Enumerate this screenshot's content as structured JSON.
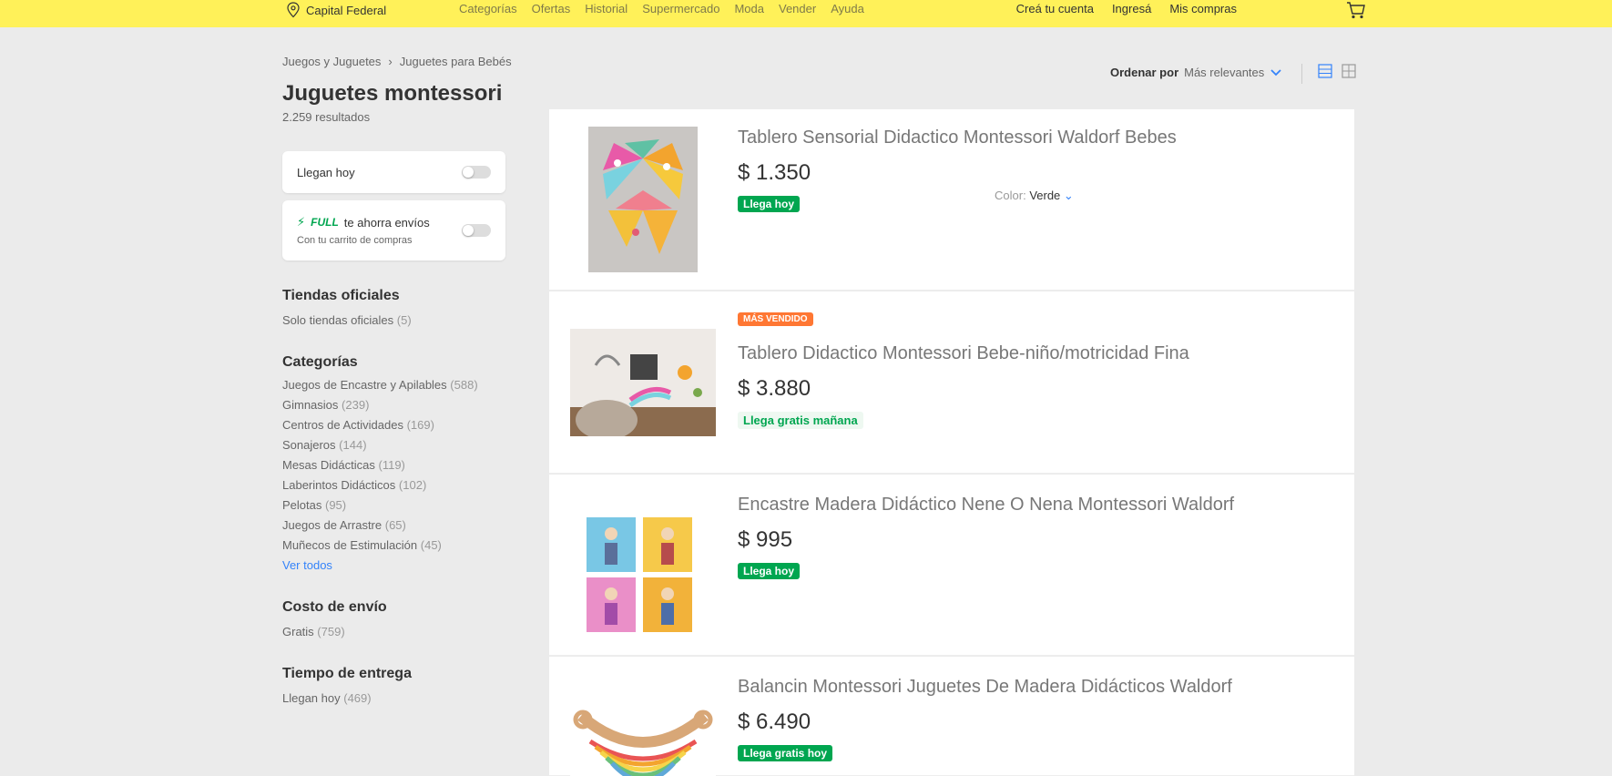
{
  "header": {
    "location": "Capital Federal",
    "nav": [
      "Categorías",
      "Ofertas",
      "Historial",
      "Supermercado",
      "Moda",
      "Vender",
      "Ayuda"
    ],
    "user_nav": [
      "Creá tu cuenta",
      "Ingresá",
      "Mis compras"
    ]
  },
  "breadcrumb": [
    "Juegos y Juguetes",
    "Juguetes para Bebés"
  ],
  "search": {
    "title": "Juguetes montessori",
    "results": "2.259 resultados"
  },
  "filters": {
    "arrive_today": "Llegan hoy",
    "full_brand": "FULL",
    "full_text": "te ahorra envíos",
    "full_sub": "Con tu carrito de compras"
  },
  "sections": {
    "stores": {
      "title": "Tiendas oficiales",
      "items": [
        {
          "label": "Solo tiendas oficiales",
          "count": "(5)"
        }
      ]
    },
    "categories": {
      "title": "Categorías",
      "items": [
        {
          "label": "Juegos de Encastre y Apilables",
          "count": "(588)"
        },
        {
          "label": "Gimnasios",
          "count": "(239)"
        },
        {
          "label": "Centros de Actividades",
          "count": "(169)"
        },
        {
          "label": "Sonajeros",
          "count": "(144)"
        },
        {
          "label": "Mesas Didácticas",
          "count": "(119)"
        },
        {
          "label": "Laberintos Didácticos",
          "count": "(102)"
        },
        {
          "label": "Pelotas",
          "count": "(95)"
        },
        {
          "label": "Juegos de Arrastre",
          "count": "(65)"
        },
        {
          "label": "Muñecos de Estimulación",
          "count": "(45)"
        }
      ],
      "see_all": "Ver todos"
    },
    "shipping_cost": {
      "title": "Costo de envío",
      "items": [
        {
          "label": "Gratis",
          "count": "(759)"
        }
      ]
    },
    "delivery_time": {
      "title": "Tiempo de entrega",
      "items": [
        {
          "label": "Llegan hoy",
          "count": "(469)"
        }
      ]
    }
  },
  "sort": {
    "label": "Ordenar por",
    "value": "Más relevantes"
  },
  "products": [
    {
      "title": "Tablero Sensorial Didactico Montessori Waldorf Bebes",
      "price": "$ 1.350",
      "badge": "Llega hoy",
      "variant_label": "Color:",
      "variant_value": "Verde"
    },
    {
      "pre_badge": "MÁS VENDIDO",
      "title": "Tablero Didactico Montessori Bebe-niño/motricidad Fina",
      "price": "$ 3.880",
      "shipping": "Llega gratis mañana"
    },
    {
      "title": "Encastre Madera Didáctico Nene O Nena Montessori Waldorf",
      "price": "$ 995",
      "badge": "Llega hoy"
    },
    {
      "title": "Balancin Montessori Juguetes De Madera Didácticos Waldorf",
      "price": "$ 6.490",
      "badge": "Llega gratis hoy"
    }
  ],
  "colors": {
    "header": "#fff159",
    "green": "#00a650",
    "orange": "#ff7733",
    "blue": "#3483fa"
  }
}
